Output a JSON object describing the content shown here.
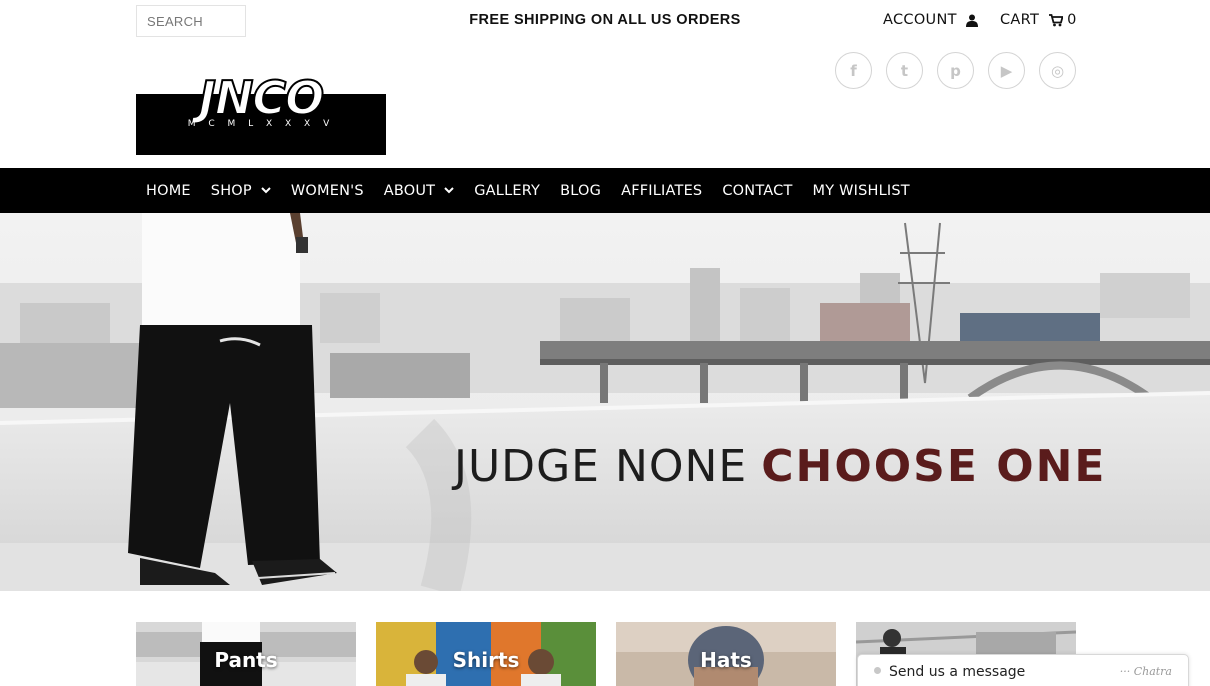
{
  "search": {
    "placeholder": "SEARCH"
  },
  "promo": {
    "text": "FREE SHIPPING ON ALL US ORDERS"
  },
  "account": {
    "label": "ACCOUNT",
    "icon": "user-icon"
  },
  "cart": {
    "label": "CART",
    "icon": "cart-icon",
    "count": "0"
  },
  "social": [
    {
      "name": "facebook-icon",
      "glyph": "f"
    },
    {
      "name": "twitter-icon",
      "glyph": "t"
    },
    {
      "name": "pinterest-icon",
      "glyph": "p"
    },
    {
      "name": "youtube-icon",
      "glyph": "▶"
    },
    {
      "name": "instagram-icon",
      "glyph": "◎"
    }
  ],
  "logo": {
    "wordmark": "JNCO",
    "tagline": "M C M L X X X V"
  },
  "nav": {
    "items": [
      {
        "label": "HOME",
        "dropdown": false
      },
      {
        "label": "SHOP",
        "dropdown": true
      },
      {
        "label": "WOMEN'S",
        "dropdown": false
      },
      {
        "label": "ABOUT",
        "dropdown": true
      },
      {
        "label": "GALLERY",
        "dropdown": false
      },
      {
        "label": "BLOG",
        "dropdown": false
      },
      {
        "label": "AFFILIATES",
        "dropdown": false
      },
      {
        "label": "CONTACT",
        "dropdown": false
      },
      {
        "label": "MY WISHLIST",
        "dropdown": false
      }
    ]
  },
  "hero": {
    "text_light": "JUDGE NONE",
    "text_bold": "CHOOSE ONE",
    "accent": "#5a1c1c"
  },
  "tiles": [
    {
      "label": "Pants"
    },
    {
      "label": "Shirts"
    },
    {
      "label": "Hats"
    },
    {
      "label": ""
    }
  ],
  "chat": {
    "message": "Send us a message",
    "brand": "··· Chatra"
  }
}
